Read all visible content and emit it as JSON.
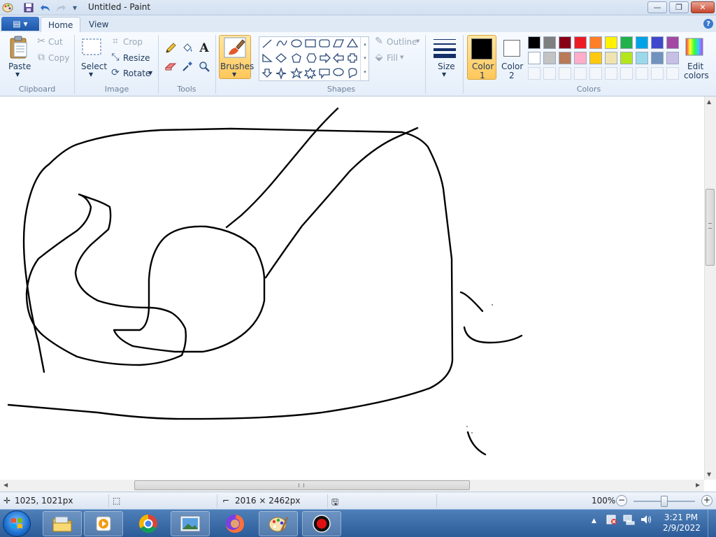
{
  "window": {
    "title": "Untitled - Paint",
    "minimize_glyph": "—",
    "maximize_glyph": "❐",
    "close_glyph": "✕"
  },
  "quick_access": {
    "save_icon": "save-icon",
    "undo_icon": "undo-icon",
    "redo_icon": "redo-icon",
    "customize_glyph": "▾"
  },
  "tabs": {
    "file_glyph": "▤ ▾",
    "home": "Home",
    "view": "View",
    "help_glyph": "?"
  },
  "clipboard": {
    "paste": "Paste",
    "cut": "Cut",
    "copy": "Copy",
    "group": "Clipboard"
  },
  "image": {
    "select": "Select",
    "crop": "Crop",
    "resize": "Resize",
    "rotate": "Rotate",
    "group": "Image"
  },
  "tools": {
    "group": "Tools",
    "text_glyph": "A"
  },
  "brushes": {
    "label": "Brushes"
  },
  "shapes": {
    "outline": "Outline",
    "fill": "Fill",
    "group": "Shapes"
  },
  "size": {
    "label": "Size"
  },
  "colors": {
    "color1_line1": "Color",
    "color1_line2": "1",
    "color2_line1": "Color",
    "color2_line2": "2",
    "edit_line1": "Edit",
    "edit_line2": "colors",
    "group": "Colors",
    "color1_value": "#000000",
    "color2_value": "#ffffff",
    "palette_row1": [
      "#000000",
      "#7f7f7f",
      "#880015",
      "#ed1c24",
      "#ff7f27",
      "#fff200",
      "#22b14c",
      "#00a2e8",
      "#3f48cc",
      "#a349a4"
    ],
    "palette_row2": [
      "#ffffff",
      "#c3c3c3",
      "#b97a57",
      "#ffaec9",
      "#ffc90e",
      "#efe4b0",
      "#b5e61d",
      "#99d9ea",
      "#7092be",
      "#c8bfe7"
    ]
  },
  "status": {
    "cursor_pos": "1025, 1021px",
    "canvas_size": "2016 × 2462px",
    "zoom": "100%",
    "zoom_out_glyph": "−",
    "zoom_in_glyph": "+"
  },
  "taskbar": {
    "time": "3:21 PM",
    "date": "2/9/2022",
    "tray_arrow": "▲"
  }
}
